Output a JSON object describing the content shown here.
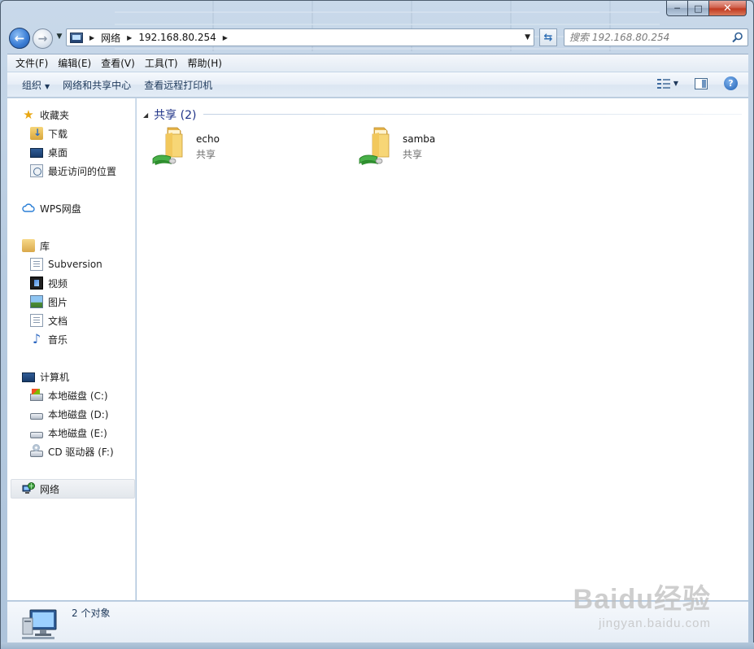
{
  "window": {
    "controls": {
      "minimize": "─",
      "maximize": "□",
      "close": "✕"
    }
  },
  "navigation": {
    "breadcrumbs": [
      "网络",
      "192.168.80.254"
    ],
    "search_placeholder": "搜索 192.168.80.254"
  },
  "menubar": {
    "items": [
      "文件(F)",
      "编辑(E)",
      "查看(V)",
      "工具(T)",
      "帮助(H)"
    ]
  },
  "commandbar": {
    "organize": "组织",
    "network_center": "网络和共享中心",
    "view_printers": "查看远程打印机"
  },
  "sidebar": {
    "favorites": {
      "label": "收藏夹",
      "icon": "star-icon"
    },
    "favorites_items": [
      {
        "label": "下载",
        "icon": "downloads-folder-icon"
      },
      {
        "label": "桌面",
        "icon": "desktop-icon"
      },
      {
        "label": "最近访问的位置",
        "icon": "recent-places-icon"
      }
    ],
    "wps": {
      "label": "WPS网盘",
      "icon": "cloud-icon"
    },
    "libraries": {
      "label": "库",
      "icon": "library-icon"
    },
    "library_items": [
      {
        "label": "Subversion",
        "icon": "document-icon"
      },
      {
        "label": "视频",
        "icon": "video-icon"
      },
      {
        "label": "图片",
        "icon": "picture-icon"
      },
      {
        "label": "文档",
        "icon": "document-icon"
      },
      {
        "label": "音乐",
        "icon": "music-icon"
      }
    ],
    "computer": {
      "label": "计算机",
      "icon": "computer-icon"
    },
    "computer_items": [
      {
        "label": "本地磁盘 (C:)",
        "icon": "system-drive-icon"
      },
      {
        "label": "本地磁盘 (D:)",
        "icon": "drive-icon"
      },
      {
        "label": "本地磁盘 (E:)",
        "icon": "drive-icon"
      },
      {
        "label": "CD 驱动器 (F:)",
        "icon": "cd-drive-icon"
      }
    ],
    "network": {
      "label": "网络",
      "icon": "network-icon",
      "selected": true
    }
  },
  "content": {
    "group_title": "共享 (2)",
    "items": [
      {
        "name": "echo",
        "type": "共享",
        "icon": "shared-folder-icon"
      },
      {
        "name": "samba",
        "type": "共享",
        "icon": "shared-folder-icon"
      }
    ]
  },
  "details": {
    "count": "2 个对象"
  },
  "watermark": {
    "main": "Baidu经验",
    "sub": "jingyan.baidu.com"
  },
  "colors": {
    "accent": "#1e3287",
    "command_text": "#1e395b",
    "folder": "#f3cf6c"
  }
}
